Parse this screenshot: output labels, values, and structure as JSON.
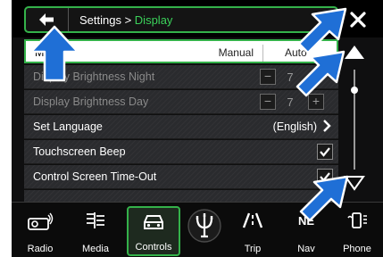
{
  "header": {
    "back_icon": "left-arrow-icon",
    "breadcrumb_parent": "Settings > ",
    "breadcrumb_current": "Display",
    "close_icon": "close-x-icon"
  },
  "list": {
    "rows": [
      {
        "label": "Mode",
        "type": "segmented",
        "options": [
          "Manual",
          "Auto"
        ],
        "selected": "Auto"
      },
      {
        "label": "Display Brightness Night",
        "type": "stepper",
        "value": "7",
        "disabled": true
      },
      {
        "label": "Display Brightness Day",
        "type": "stepper",
        "value": "7",
        "disabled": true
      },
      {
        "label": "Set Language",
        "type": "link",
        "value": "(English)"
      },
      {
        "label": "Touchscreen Beep",
        "type": "checkbox",
        "checked": true
      },
      {
        "label": "Control Screen Time-Out",
        "type": "checkbox",
        "checked": true
      }
    ]
  },
  "scrollbar": {
    "up_icon": "triangle-up-icon",
    "down_icon": "triangle-down-icon",
    "position": 0.12
  },
  "nav": {
    "items": [
      {
        "label": "Radio",
        "icon": "radio-icon"
      },
      {
        "label": "Media",
        "icon": "media-icon"
      },
      {
        "label": "Controls",
        "icon": "car-icon",
        "active": true
      },
      {
        "label": "",
        "icon": "trident-logo-icon"
      },
      {
        "label": "Trip",
        "icon": "road-icon"
      },
      {
        "label": "Nav",
        "icon": "compass-icon"
      },
      {
        "label": "Phone",
        "icon": "phone-icon"
      }
    ]
  },
  "colors": {
    "accent": "#34b24a",
    "callout": "#1f6fd6"
  }
}
